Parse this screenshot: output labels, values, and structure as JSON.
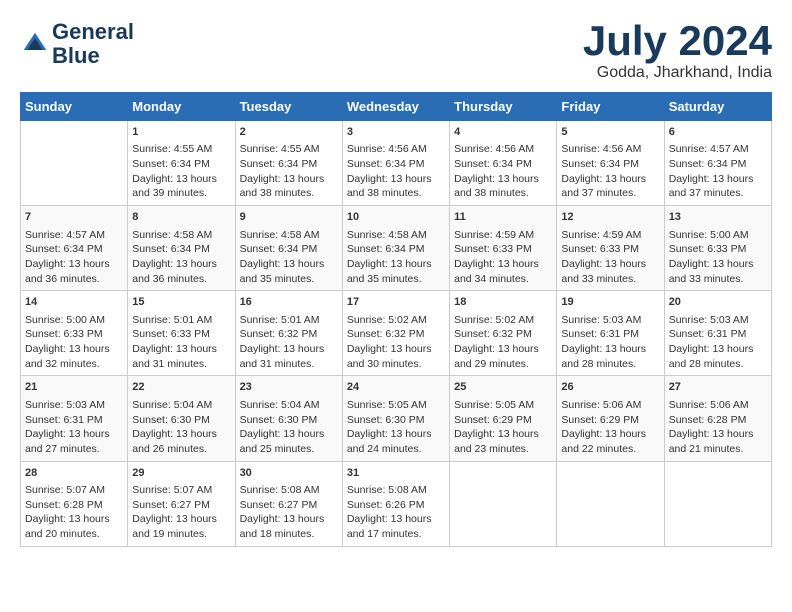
{
  "header": {
    "logo_line1": "General",
    "logo_line2": "Blue",
    "month": "July 2024",
    "location": "Godda, Jharkhand, India"
  },
  "columns": [
    "Sunday",
    "Monday",
    "Tuesday",
    "Wednesday",
    "Thursday",
    "Friday",
    "Saturday"
  ],
  "weeks": [
    [
      {
        "day": "",
        "sunrise": "",
        "sunset": "",
        "daylight": ""
      },
      {
        "day": "1",
        "sunrise": "Sunrise: 4:55 AM",
        "sunset": "Sunset: 6:34 PM",
        "daylight": "Daylight: 13 hours and 39 minutes."
      },
      {
        "day": "2",
        "sunrise": "Sunrise: 4:55 AM",
        "sunset": "Sunset: 6:34 PM",
        "daylight": "Daylight: 13 hours and 38 minutes."
      },
      {
        "day": "3",
        "sunrise": "Sunrise: 4:56 AM",
        "sunset": "Sunset: 6:34 PM",
        "daylight": "Daylight: 13 hours and 38 minutes."
      },
      {
        "day": "4",
        "sunrise": "Sunrise: 4:56 AM",
        "sunset": "Sunset: 6:34 PM",
        "daylight": "Daylight: 13 hours and 38 minutes."
      },
      {
        "day": "5",
        "sunrise": "Sunrise: 4:56 AM",
        "sunset": "Sunset: 6:34 PM",
        "daylight": "Daylight: 13 hours and 37 minutes."
      },
      {
        "day": "6",
        "sunrise": "Sunrise: 4:57 AM",
        "sunset": "Sunset: 6:34 PM",
        "daylight": "Daylight: 13 hours and 37 minutes."
      }
    ],
    [
      {
        "day": "7",
        "sunrise": "Sunrise: 4:57 AM",
        "sunset": "Sunset: 6:34 PM",
        "daylight": "Daylight: 13 hours and 36 minutes."
      },
      {
        "day": "8",
        "sunrise": "Sunrise: 4:58 AM",
        "sunset": "Sunset: 6:34 PM",
        "daylight": "Daylight: 13 hours and 36 minutes."
      },
      {
        "day": "9",
        "sunrise": "Sunrise: 4:58 AM",
        "sunset": "Sunset: 6:34 PM",
        "daylight": "Daylight: 13 hours and 35 minutes."
      },
      {
        "day": "10",
        "sunrise": "Sunrise: 4:58 AM",
        "sunset": "Sunset: 6:34 PM",
        "daylight": "Daylight: 13 hours and 35 minutes."
      },
      {
        "day": "11",
        "sunrise": "Sunrise: 4:59 AM",
        "sunset": "Sunset: 6:33 PM",
        "daylight": "Daylight: 13 hours and 34 minutes."
      },
      {
        "day": "12",
        "sunrise": "Sunrise: 4:59 AM",
        "sunset": "Sunset: 6:33 PM",
        "daylight": "Daylight: 13 hours and 33 minutes."
      },
      {
        "day": "13",
        "sunrise": "Sunrise: 5:00 AM",
        "sunset": "Sunset: 6:33 PM",
        "daylight": "Daylight: 13 hours and 33 minutes."
      }
    ],
    [
      {
        "day": "14",
        "sunrise": "Sunrise: 5:00 AM",
        "sunset": "Sunset: 6:33 PM",
        "daylight": "Daylight: 13 hours and 32 minutes."
      },
      {
        "day": "15",
        "sunrise": "Sunrise: 5:01 AM",
        "sunset": "Sunset: 6:33 PM",
        "daylight": "Daylight: 13 hours and 31 minutes."
      },
      {
        "day": "16",
        "sunrise": "Sunrise: 5:01 AM",
        "sunset": "Sunset: 6:32 PM",
        "daylight": "Daylight: 13 hours and 31 minutes."
      },
      {
        "day": "17",
        "sunrise": "Sunrise: 5:02 AM",
        "sunset": "Sunset: 6:32 PM",
        "daylight": "Daylight: 13 hours and 30 minutes."
      },
      {
        "day": "18",
        "sunrise": "Sunrise: 5:02 AM",
        "sunset": "Sunset: 6:32 PM",
        "daylight": "Daylight: 13 hours and 29 minutes."
      },
      {
        "day": "19",
        "sunrise": "Sunrise: 5:03 AM",
        "sunset": "Sunset: 6:31 PM",
        "daylight": "Daylight: 13 hours and 28 minutes."
      },
      {
        "day": "20",
        "sunrise": "Sunrise: 5:03 AM",
        "sunset": "Sunset: 6:31 PM",
        "daylight": "Daylight: 13 hours and 28 minutes."
      }
    ],
    [
      {
        "day": "21",
        "sunrise": "Sunrise: 5:03 AM",
        "sunset": "Sunset: 6:31 PM",
        "daylight": "Daylight: 13 hours and 27 minutes."
      },
      {
        "day": "22",
        "sunrise": "Sunrise: 5:04 AM",
        "sunset": "Sunset: 6:30 PM",
        "daylight": "Daylight: 13 hours and 26 minutes."
      },
      {
        "day": "23",
        "sunrise": "Sunrise: 5:04 AM",
        "sunset": "Sunset: 6:30 PM",
        "daylight": "Daylight: 13 hours and 25 minutes."
      },
      {
        "day": "24",
        "sunrise": "Sunrise: 5:05 AM",
        "sunset": "Sunset: 6:30 PM",
        "daylight": "Daylight: 13 hours and 24 minutes."
      },
      {
        "day": "25",
        "sunrise": "Sunrise: 5:05 AM",
        "sunset": "Sunset: 6:29 PM",
        "daylight": "Daylight: 13 hours and 23 minutes."
      },
      {
        "day": "26",
        "sunrise": "Sunrise: 5:06 AM",
        "sunset": "Sunset: 6:29 PM",
        "daylight": "Daylight: 13 hours and 22 minutes."
      },
      {
        "day": "27",
        "sunrise": "Sunrise: 5:06 AM",
        "sunset": "Sunset: 6:28 PM",
        "daylight": "Daylight: 13 hours and 21 minutes."
      }
    ],
    [
      {
        "day": "28",
        "sunrise": "Sunrise: 5:07 AM",
        "sunset": "Sunset: 6:28 PM",
        "daylight": "Daylight: 13 hours and 20 minutes."
      },
      {
        "day": "29",
        "sunrise": "Sunrise: 5:07 AM",
        "sunset": "Sunset: 6:27 PM",
        "daylight": "Daylight: 13 hours and 19 minutes."
      },
      {
        "day": "30",
        "sunrise": "Sunrise: 5:08 AM",
        "sunset": "Sunset: 6:27 PM",
        "daylight": "Daylight: 13 hours and 18 minutes."
      },
      {
        "day": "31",
        "sunrise": "Sunrise: 5:08 AM",
        "sunset": "Sunset: 6:26 PM",
        "daylight": "Daylight: 13 hours and 17 minutes."
      },
      {
        "day": "",
        "sunrise": "",
        "sunset": "",
        "daylight": ""
      },
      {
        "day": "",
        "sunrise": "",
        "sunset": "",
        "daylight": ""
      },
      {
        "day": "",
        "sunrise": "",
        "sunset": "",
        "daylight": ""
      }
    ]
  ]
}
